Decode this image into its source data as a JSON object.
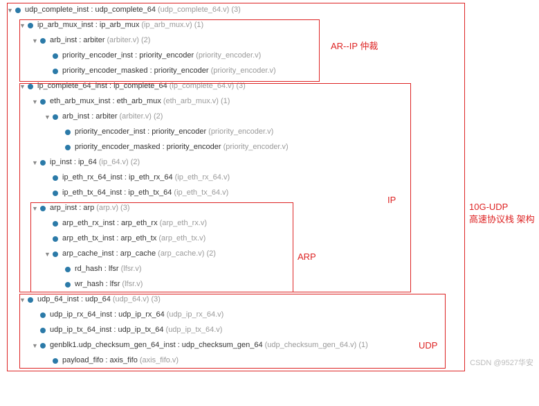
{
  "watermark": "CSDN @9527华安",
  "annotations": {
    "ar_ip": "AR--IP 仲裁",
    "ip": "IP",
    "arp": "ARP",
    "udp": "UDP",
    "main": "10G-UDP\n高速协议栈 架构"
  },
  "rows": [
    {
      "d": 0,
      "a": "v",
      "t": "udp_complete_inst : udp_complete_64",
      "s": "(udp_complete_64.v) (3)"
    },
    {
      "d": 1,
      "a": "v",
      "t": "ip_arb_mux_inst : ip_arb_mux",
      "s": "(ip_arb_mux.v) (1)"
    },
    {
      "d": 2,
      "a": "v",
      "t": "arb_inst : arbiter",
      "s": "(arbiter.v) (2)"
    },
    {
      "d": 3,
      "a": "",
      "t": "priority_encoder_inst : priority_encoder",
      "s": "(priority_encoder.v)"
    },
    {
      "d": 3,
      "a": "",
      "t": "priority_encoder_masked : priority_encoder",
      "s": "(priority_encoder.v)"
    },
    {
      "d": 1,
      "a": "v",
      "t": "ip_complete_64_inst : ip_complete_64",
      "s": "(ip_complete_64.v) (3)"
    },
    {
      "d": 2,
      "a": "v",
      "t": "eth_arb_mux_inst : eth_arb_mux",
      "s": "(eth_arb_mux.v) (1)"
    },
    {
      "d": 3,
      "a": "v",
      "t": "arb_inst : arbiter",
      "s": "(arbiter.v) (2)"
    },
    {
      "d": 4,
      "a": "",
      "t": "priority_encoder_inst : priority_encoder",
      "s": "(priority_encoder.v)"
    },
    {
      "d": 4,
      "a": "",
      "t": "priority_encoder_masked : priority_encoder",
      "s": "(priority_encoder.v)"
    },
    {
      "d": 2,
      "a": "v",
      "t": "ip_inst : ip_64",
      "s": "(ip_64.v) (2)"
    },
    {
      "d": 3,
      "a": "",
      "t": "ip_eth_rx_64_inst : ip_eth_rx_64",
      "s": "(ip_eth_rx_64.v)"
    },
    {
      "d": 3,
      "a": "",
      "t": "ip_eth_tx_64_inst : ip_eth_tx_64",
      "s": "(ip_eth_tx_64.v)"
    },
    {
      "d": 2,
      "a": "v",
      "t": "arp_inst : arp",
      "s": "(arp.v) (3)"
    },
    {
      "d": 3,
      "a": "",
      "t": "arp_eth_rx_inst : arp_eth_rx",
      "s": "(arp_eth_rx.v)"
    },
    {
      "d": 3,
      "a": "",
      "t": "arp_eth_tx_inst : arp_eth_tx",
      "s": "(arp_eth_tx.v)"
    },
    {
      "d": 3,
      "a": "v",
      "t": "arp_cache_inst : arp_cache",
      "s": "(arp_cache.v) (2)"
    },
    {
      "d": 4,
      "a": "",
      "t": "rd_hash : lfsr",
      "s": "(lfsr.v)"
    },
    {
      "d": 4,
      "a": "",
      "t": "wr_hash : lfsr",
      "s": "(lfsr.v)"
    },
    {
      "d": 1,
      "a": "v",
      "t": "udp_64_inst : udp_64",
      "s": "(udp_64.v) (3)"
    },
    {
      "d": 2,
      "a": "",
      "t": "udp_ip_rx_64_inst : udp_ip_rx_64",
      "s": "(udp_ip_rx_64.v)"
    },
    {
      "d": 2,
      "a": "",
      "t": "udp_ip_tx_64_inst : udp_ip_tx_64",
      "s": "(udp_ip_tx_64.v)"
    },
    {
      "d": 2,
      "a": "v",
      "t": "genblk1.udp_checksum_gen_64_inst : udp_checksum_gen_64",
      "s": "(udp_checksum_gen_64.v) (1)"
    },
    {
      "d": 3,
      "a": "",
      "t": "payload_fifo : axis_fifo",
      "s": "(axis_fifo.v)"
    }
  ]
}
